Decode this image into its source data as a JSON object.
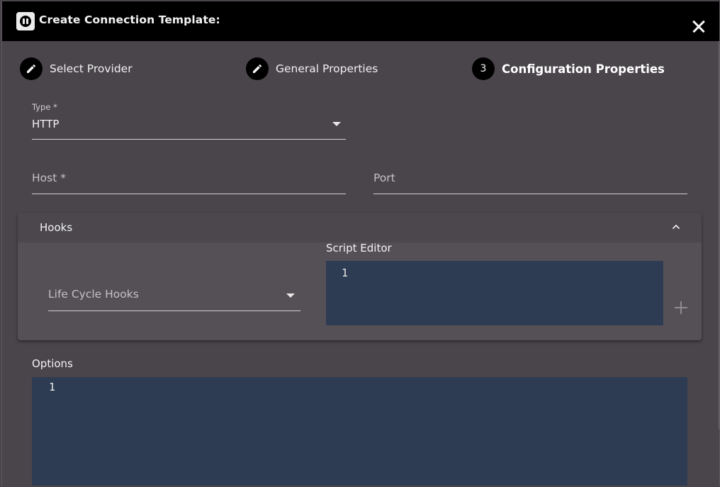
{
  "dialog": {
    "title": "Create Connection Template:"
  },
  "stepper": [
    {
      "label": "Select Provider",
      "icon": "pencil-icon"
    },
    {
      "label": "General Properties",
      "icon": "pencil-icon"
    },
    {
      "label": "Configuration Properties",
      "number": "3"
    }
  ],
  "form": {
    "type_label": "Type *",
    "type_value": "HTTP",
    "host_placeholder": "Host *",
    "port_placeholder": "Port"
  },
  "hooks": {
    "title": "Hooks",
    "lifecycle_placeholder": "Life Cycle Hooks",
    "script_editor_label": "Script Editor",
    "script_line": "1"
  },
  "options": {
    "label": "Options",
    "line": "1"
  },
  "colors": {
    "background": "#4a454b",
    "titlebar": "#000000",
    "editor": "#2e3c53",
    "hooks_body": "#555055"
  }
}
